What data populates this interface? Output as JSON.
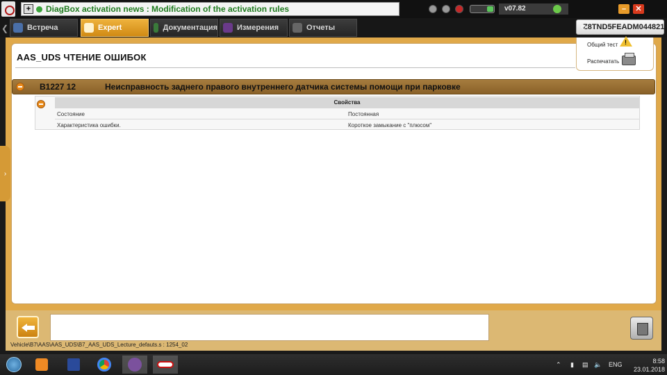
{
  "topbar": {
    "news_text": "DiagBox activation news : Modification of the activation rules",
    "version": "v07.82",
    "colors": {
      "news_text": "#1d7a1d",
      "accent": "#e0a94a"
    }
  },
  "tabs": [
    {
      "label": "Встреча",
      "icon": "meeting-icon"
    },
    {
      "label": "Expert",
      "icon": "magnifier-icon"
    },
    {
      "label": "Документация",
      "icon": "book-icon"
    },
    {
      "label": "Измерения",
      "icon": "wave-icon"
    },
    {
      "label": "Отчеты",
      "icon": "report-icon"
    }
  ],
  "vin": "Z8TND5FEADM044821",
  "side_menu": {
    "global_test": "Общий тест",
    "print": "Распечатать"
  },
  "page": {
    "title": "AAS_UDS  ЧТЕНИЕ ОШИБОК"
  },
  "dtc": {
    "code": "B1227 12",
    "description": "Неисправность заднего правого внутреннего датчика системы помощи при парковке"
  },
  "properties": {
    "header": "Свойства",
    "rows": [
      {
        "key": "Состояние",
        "value": "Постоянная"
      },
      {
        "key": "Характеристика ошибки.",
        "value": "Короткое замыкание с \"плюсом\""
      }
    ]
  },
  "status_path": "Vehicle\\B7\\AAS\\AAS_UDS\\B7_AAS_UDS_Lecture_defauts.s : 1254_02",
  "taskbar": {
    "language": "ENG",
    "time": "8:58",
    "date": "23.01.2018"
  }
}
